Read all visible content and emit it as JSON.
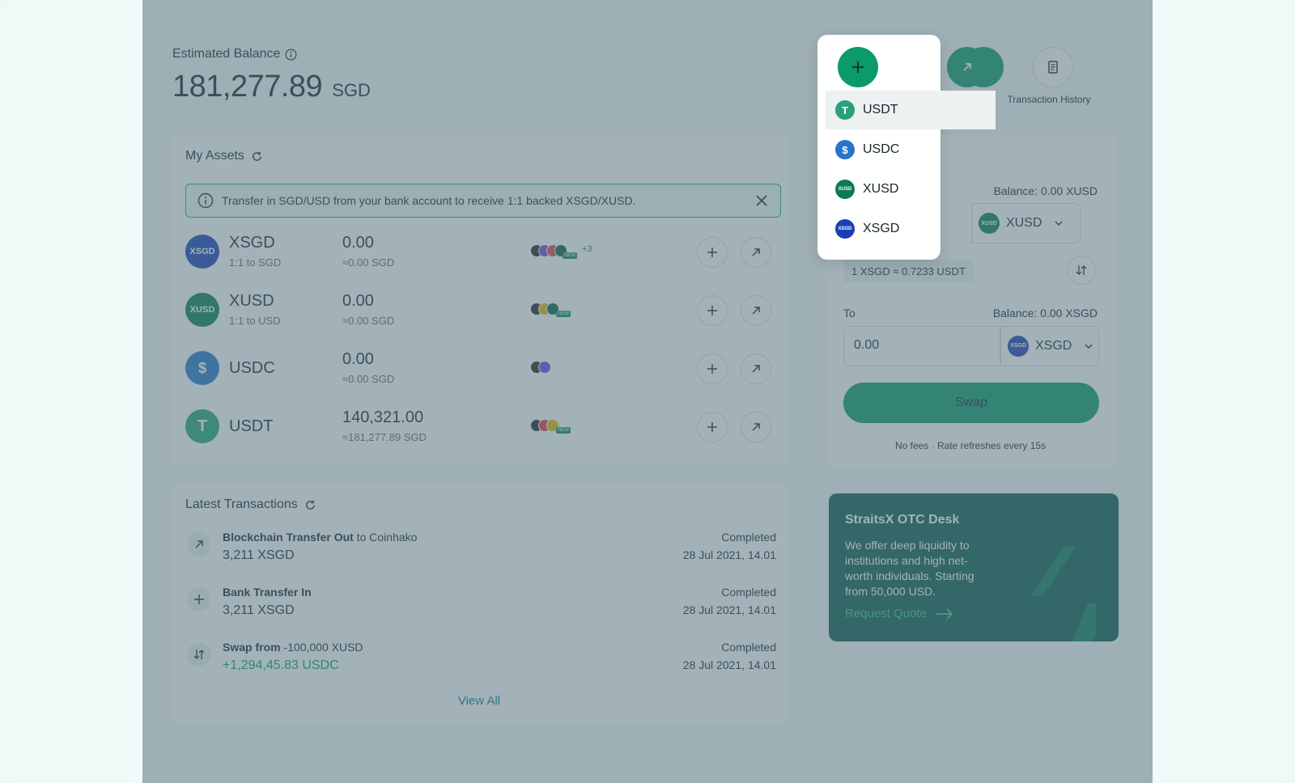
{
  "balance": {
    "label": "Estimated Balance",
    "amount": "181,277.89",
    "currency": "SGD"
  },
  "actions": {
    "history_label": "Transaction History"
  },
  "assets": {
    "title": "My Assets",
    "banner": "Transfer in SGD/USD from your bank account to receive 1:1 backed XSGD/XUSD.",
    "items": [
      {
        "name": "XSGD",
        "sub": "1:1 to SGD",
        "amount": "0.00",
        "approx": "≈0.00 SGD",
        "color": "#1a3fb5",
        "extra_chains": "+3"
      },
      {
        "name": "XUSD",
        "sub": "1:1 to USD",
        "amount": "0.00",
        "approx": "≈0.00 SGD",
        "color": "#0b7a55"
      },
      {
        "name": "USDC",
        "sub": "",
        "amount": "0.00",
        "approx": "≈0.00 SGD",
        "color": "#2775ca"
      },
      {
        "name": "USDT",
        "sub": "",
        "amount": "140,321.00",
        "approx": "≈181,277.89 SGD",
        "color": "#26a17b"
      }
    ],
    "new_badge": "NEW"
  },
  "transactions": {
    "title": "Latest Transactions",
    "items": [
      {
        "label_bold": "Blockchain Transfer Out",
        "label_rest": " to Coinhako",
        "amount": "3,211 XSGD",
        "status": "Completed",
        "date": "28 Jul 2021, 14.01"
      },
      {
        "label_bold": "Bank Transfer In",
        "label_rest": "",
        "amount": "3,211 XSGD",
        "status": "Completed",
        "date": "28 Jul 2021, 14.01"
      },
      {
        "label_bold": "Swap from",
        "label_rest": " -100,000 XUSD",
        "amount": "+1,294,45.83 USDC",
        "status": "Completed",
        "date": "28 Jul 2021, 14.01"
      }
    ],
    "view_all": "View All"
  },
  "swap": {
    "from_balance": "Balance: 0.00 XUSD",
    "from_token": "XUSD",
    "rate": "1 XSGD ≈ 0.7233 USDT",
    "to_label": "To",
    "to_balance": "Balance: 0.00 XSGD",
    "to_value": "0.00",
    "to_token": "XSGD",
    "swap_button": "Swap",
    "note": "No fees · Rate refreshes every 15s"
  },
  "otc": {
    "title": "StraitsX OTC Desk",
    "body": "We offer deep liquidity to institutions and high net-worth individuals. Starting from 50,000 USD.",
    "cta": "Request Quote"
  },
  "dropdown": {
    "items": [
      {
        "label": "USDT",
        "color": "#26a17b"
      },
      {
        "label": "USDC",
        "color": "#2775ca"
      },
      {
        "label": "XUSD",
        "color": "#0b7a55"
      },
      {
        "label": "XSGD",
        "color": "#1a3fb5"
      }
    ]
  },
  "colors": {
    "accent": "#0b9a6a",
    "otc_bg": "#0c5a4c"
  }
}
